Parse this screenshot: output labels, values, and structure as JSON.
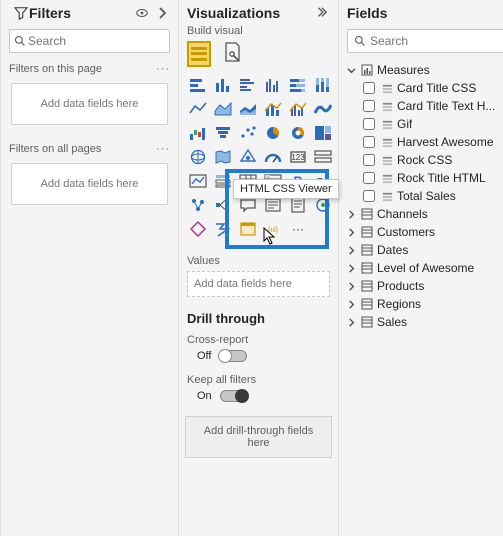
{
  "filters": {
    "title": "Filters",
    "search_placeholder": "Search",
    "section_page": "Filters on this page",
    "section_all": "Filters on all pages",
    "dropzone_label": "Add data fields here"
  },
  "viz": {
    "title": "Visualizations",
    "subtitle": "Build visual",
    "tooltip": "HTML CSS Viewer",
    "values_label": "Values",
    "values_well": "Add data fields here",
    "drill_title": "Drill through",
    "cross_report_label": "Cross-report",
    "cross_report_state": "Off",
    "keep_filters_label": "Keep all filters",
    "keep_filters_state": "On",
    "drill_well": "Add drill-through fields here",
    "more": "···"
  },
  "fields": {
    "title": "Fields",
    "search_placeholder": "Search",
    "tables": [
      {
        "name": "Measures",
        "expanded": true,
        "children": [
          "Card Title CSS",
          "Card Title Text H...",
          "Gif",
          "Harvest Awesome",
          "Rock CSS",
          "Rock Title HTML",
          "Total Sales"
        ]
      },
      {
        "name": "Channels",
        "expanded": false
      },
      {
        "name": "Customers",
        "expanded": false
      },
      {
        "name": "Dates",
        "expanded": false
      },
      {
        "name": "Level of Awesome",
        "expanded": false
      },
      {
        "name": "Products",
        "expanded": false
      },
      {
        "name": "Regions",
        "expanded": false
      },
      {
        "name": "Sales",
        "expanded": false
      }
    ]
  }
}
